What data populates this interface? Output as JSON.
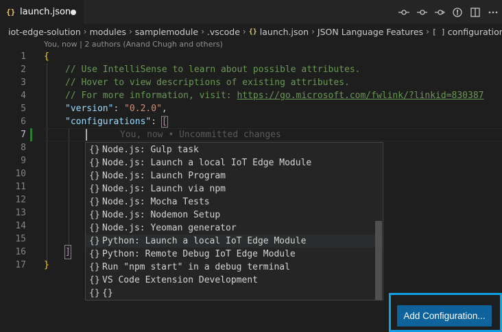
{
  "tab": {
    "icon_text": "{}",
    "title": "launch.json",
    "dirty": true
  },
  "toolbar": {
    "icons": [
      "git-compare-icon",
      "git-commit-prev-icon",
      "git-commit-next-icon",
      "open-changes-icon",
      "split-editor-icon",
      "more-actions-icon"
    ]
  },
  "breadcrumb": {
    "items": [
      "iot-edge-solution",
      "modules",
      "samplemodule",
      ".vscode",
      "launch.json",
      "JSON Language Features",
      "configurations"
    ],
    "json_icon": "{}",
    "array_icon": "[ ]"
  },
  "blame": "You, now | 2 authors (Anand Chugh and others)",
  "editor": {
    "line_numbers": [
      "1",
      "2",
      "3",
      "4",
      "5",
      "6",
      "7",
      "8",
      "9",
      "10",
      "11",
      "12",
      "13",
      "14",
      "15",
      "16",
      "17"
    ],
    "active_line": "7",
    "code": {
      "l1": "{",
      "l2": "// Use IntelliSense to learn about possible attributes.",
      "l3": "// Hover to view descriptions of existing attributes.",
      "l4_prefix": "// For more information, visit: ",
      "l4_link": "https://go.microsoft.com/fwlink/?linkid=830387",
      "l5_key": "\"version\"",
      "l5_colon": ": ",
      "l5_value": "\"0.2.0\"",
      "l5_comma": ",",
      "l6_key": "\"configurations\"",
      "l6_colon": ": ",
      "l6_bracket": "[",
      "l16": "]",
      "l17": "}"
    },
    "ghost_text": "You, now • Uncommitted changes"
  },
  "suggestions": {
    "icon": "{}",
    "items": [
      "Node.js: Gulp task",
      "Node.js: Launch a local IoT Edge Module",
      "Node.js: Launch Program",
      "Node.js: Launch via npm",
      "Node.js: Mocha Tests",
      "Node.js: Nodemon Setup",
      "Node.js: Yeoman generator",
      "Python: Launch a local IoT Edge Module",
      "Python: Remote Debug IoT Edge Module",
      "Run \"npm start\" in a debug terminal",
      "VS Code Extension Development",
      "{}"
    ],
    "focused_index": 7
  },
  "button": {
    "label": "Add Configuration..."
  },
  "colors": {
    "accent_frame": "#0fa0e6",
    "button_bg": "#0e639c",
    "editor_bg": "#1e1e1e"
  }
}
